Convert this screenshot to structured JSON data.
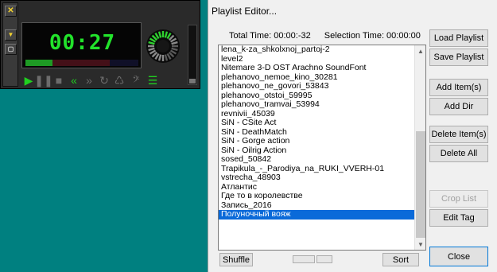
{
  "player": {
    "time": "00:27",
    "side_buttons": [
      "close-icon",
      "minimize-icon",
      "window-icon"
    ],
    "controls": [
      {
        "name": "play-icon",
        "glyph": "▶",
        "active": true
      },
      {
        "name": "pause-icon",
        "glyph": "❚❚",
        "active": false
      },
      {
        "name": "stop-icon",
        "glyph": "■",
        "active": false
      },
      {
        "name": "rewind-icon",
        "glyph": "«",
        "active": true
      },
      {
        "name": "forward-icon",
        "glyph": "»",
        "active": false
      },
      {
        "name": "repeat-icon",
        "glyph": "↻",
        "active": false
      },
      {
        "name": "recycle-icon",
        "glyph": "♺",
        "active": false
      },
      {
        "name": "bass-clef-icon",
        "glyph": "𝄢",
        "active": false
      },
      {
        "name": "playlist-icon",
        "glyph": "☰",
        "active": true
      }
    ],
    "colors": {
      "accent": "#22e32b",
      "frame": "#2a2a2a"
    }
  },
  "playlist": {
    "title": "Playlist Editor...",
    "total_time_label": "Total Time: 00:00:-32",
    "selection_time_label": "Selection Time: 00:00:00",
    "items": [
      "lena_k-za_shkolxnoj_partoj-2",
      "level2",
      "Nitemare 3-D OST Arachno SoundFont",
      "plehanovo_nemoe_kino_30281",
      "plehanovo_ne_govori_53843",
      "plehanovo_otstoi_59995",
      "plehanovo_tramvai_53994",
      "revnivii_45039",
      "SiN - CSite Act",
      "SiN - DeathMatch",
      "SiN - Gorge action",
      "SiN - Oilrig Action",
      "sosed_50842",
      "Trapikula_-_Parodiya_na_RUKI_VVERH-01",
      "vstrecha_48903",
      "Атлантис",
      "Где то в королевстве",
      "Запись_2016",
      "Полуночный вояж"
    ],
    "selected_index": 18,
    "buttons": {
      "shuffle": "Shuffle",
      "sort": "Sort",
      "load": "Load Playlist",
      "save": "Save Playlist",
      "add_item": "Add Item(s)",
      "add_dir": "Add Dir",
      "delete_item": "Delete Item(s)",
      "delete_all": "Delete All",
      "crop": "Crop List",
      "edit_tag": "Edit Tag",
      "close": "Close"
    },
    "colors": {
      "selection": "#0a6ad9",
      "dialog_bg": "#f0f0f0",
      "desktop": "#008080"
    }
  }
}
